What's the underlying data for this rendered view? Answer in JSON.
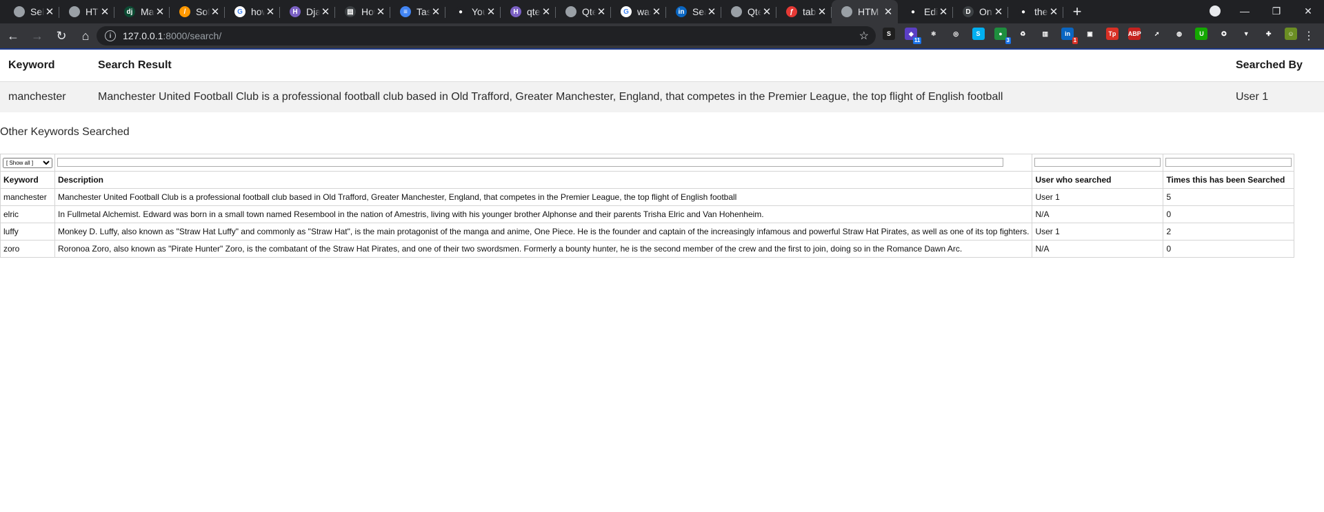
{
  "browser": {
    "tabs": [
      {
        "title": "Sele",
        "icon": "globe-icon",
        "color": "#9aa0a6",
        "glyph": ""
      },
      {
        "title": "HTM",
        "icon": "globe-icon",
        "color": "#9aa0a6",
        "glyph": ""
      },
      {
        "title": "Man",
        "icon": "django-icon",
        "color": "#0c4b33",
        "glyph": "dj"
      },
      {
        "title": "Soft",
        "icon": "sublime-icon",
        "color": "#ff9800",
        "glyph": "/"
      },
      {
        "title": "how",
        "icon": "google-icon",
        "color": "#ffffff",
        "glyph": "G"
      },
      {
        "title": "Djan",
        "icon": "hashnode-icon",
        "color": "#7b61c4",
        "glyph": "H"
      },
      {
        "title": "How",
        "icon": "news-icon",
        "color": "#3c4043",
        "glyph": "▤"
      },
      {
        "title": "Task",
        "icon": "docs-icon",
        "color": "#4285f4",
        "glyph": "≡"
      },
      {
        "title": "Your",
        "icon": "github-icon",
        "color": "#202124",
        "glyph": "●"
      },
      {
        "title": "qtec",
        "icon": "hashnode-icon",
        "color": "#7b61c4",
        "glyph": "H"
      },
      {
        "title": "Qtec",
        "icon": "globe-icon",
        "color": "#9aa0a6",
        "glyph": ""
      },
      {
        "title": "was",
        "icon": "google-icon",
        "color": "#ffffff",
        "glyph": "G"
      },
      {
        "title": "Sear",
        "icon": "linkedin-icon",
        "color": "#0a66c2",
        "glyph": "in"
      },
      {
        "title": "Qtec",
        "icon": "globe-icon",
        "color": "#9aa0a6",
        "glyph": ""
      },
      {
        "title": "table",
        "icon": "flash-icon",
        "color": "#e53935",
        "glyph": "ƒ"
      },
      {
        "title": "HTM",
        "icon": "globe-icon",
        "color": "#9aa0a6",
        "glyph": "",
        "active": true
      },
      {
        "title": "Edit",
        "icon": "github-icon",
        "color": "#202124",
        "glyph": "●"
      },
      {
        "title": "Onli",
        "icon": "d-icon",
        "color": "#3c4043",
        "glyph": "D"
      },
      {
        "title": "thec",
        "icon": "github-icon",
        "color": "#202124",
        "glyph": "●"
      }
    ],
    "url_host": "127.0.0.1",
    "url_rest": ":8000/search/",
    "extensions": [
      {
        "name": "s-extension-icon",
        "color": "#1f1f1f",
        "glyph": "S"
      },
      {
        "name": "adblock-icon",
        "color": "#5b3fc4",
        "glyph": "◆",
        "badge": "11"
      },
      {
        "name": "react-devtools-icon",
        "color": "#35363a",
        "glyph": "⚛"
      },
      {
        "name": "target-icon",
        "color": "#35363a",
        "glyph": "◎"
      },
      {
        "name": "skype-icon",
        "color": "#00aff0",
        "glyph": "S"
      },
      {
        "name": "green-extension-icon",
        "color": "#1e8e3e",
        "glyph": "●",
        "badge": "3"
      },
      {
        "name": "recycle-icon",
        "color": "#35363a",
        "glyph": "♻"
      },
      {
        "name": "reader-icon",
        "color": "#35363a",
        "glyph": "▥"
      },
      {
        "name": "linkedin-ext-icon",
        "color": "#0a66c2",
        "glyph": "in",
        "badge": "1",
        "badge_red": true
      },
      {
        "name": "screenshot-icon",
        "color": "#35363a",
        "glyph": "▣"
      },
      {
        "name": "tp-icon",
        "color": "#d93025",
        "glyph": "Tp"
      },
      {
        "name": "abp-icon",
        "color": "#c5221f",
        "glyph": "ABP"
      },
      {
        "name": "cursor-icon",
        "color": "#35363a",
        "glyph": "➚"
      },
      {
        "name": "globe-ext-icon",
        "color": "#35363a",
        "glyph": "◍"
      },
      {
        "name": "upwork-icon",
        "color": "#14a800",
        "glyph": "U"
      },
      {
        "name": "pin-icon",
        "color": "#35363a",
        "glyph": "✪"
      },
      {
        "name": "vue-icon",
        "color": "#35363a",
        "glyph": "▼"
      },
      {
        "name": "puzzle-icon",
        "color": "#35363a",
        "glyph": "✚"
      },
      {
        "name": "profile-avatar-icon",
        "color": "#6b8e23",
        "glyph": "☺"
      }
    ]
  },
  "result": {
    "headers": {
      "keyword": "Keyword",
      "result": "Search Result",
      "searched_by": "Searched By"
    },
    "row": {
      "keyword": "manchester",
      "result": "Manchester United Football Club is a professional football club based in Old Trafford, Greater Manchester, England, that competes in the Premier League, the top flight of English football",
      "searched_by": "User 1"
    }
  },
  "other": {
    "title": "Other Keywords Searched",
    "filter_select": "[ Show all ]",
    "headers": {
      "keyword": "Keyword",
      "description": "Description",
      "user": "User who searched",
      "times": "Times this has been Searched"
    },
    "rows": [
      {
        "keyword": "manchester",
        "description": "Manchester United Football Club is a professional football club based in Old Trafford, Greater Manchester, England, that competes in the Premier League, the top flight of English football",
        "user": "User 1",
        "times": "5"
      },
      {
        "keyword": "elric",
        "description": "In Fullmetal Alchemist. Edward was born in a small town named Resembool in the nation of Amestris, living with his younger brother Alphonse and their parents Trisha Elric and Van Hohenheim.",
        "user": "N/A",
        "times": "0"
      },
      {
        "keyword": "luffy",
        "description": "Monkey D. Luffy, also known as \"Straw Hat Luffy\" and commonly as \"Straw Hat\", is the main protagonist of the manga and anime, One Piece. He is the founder and captain of the increasingly infamous and powerful Straw Hat Pirates, as well as one of its top fighters.",
        "user": "User 1",
        "times": "2"
      },
      {
        "keyword": "zoro",
        "description": "Roronoa Zoro, also known as \"Pirate Hunter\" Zoro, is the combatant of the Straw Hat Pirates, and one of their two swordsmen. Formerly a bounty hunter, he is the second member of the crew and the first to join, doing so in the Romance Dawn Arc.",
        "user": "N/A",
        "times": "0"
      }
    ]
  }
}
